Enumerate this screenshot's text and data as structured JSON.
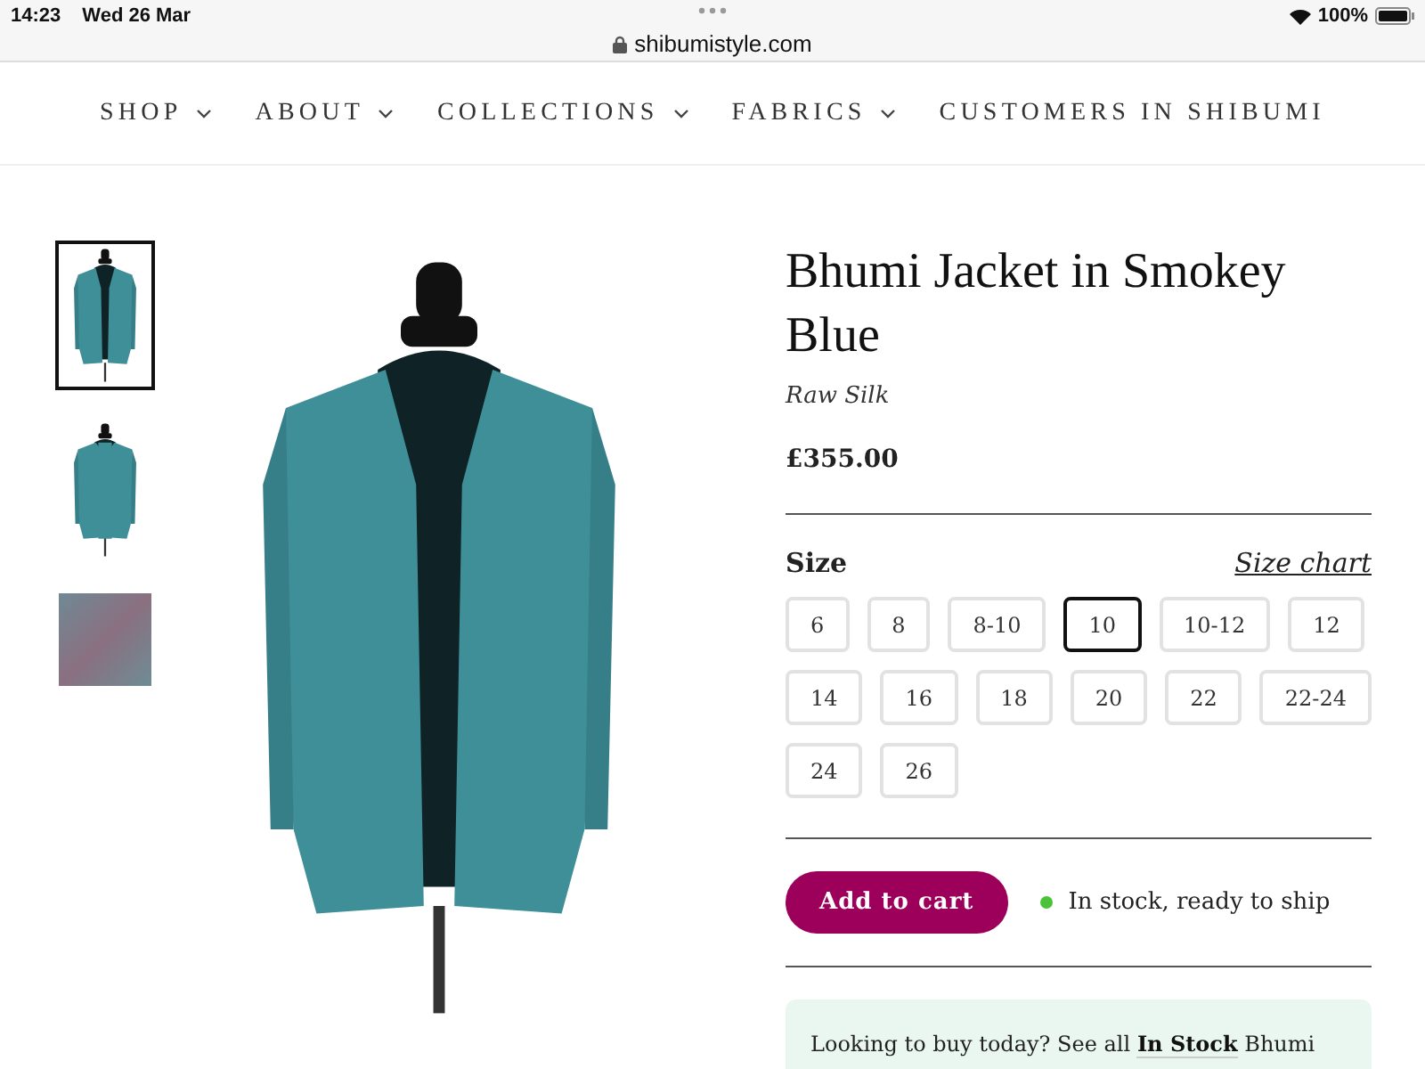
{
  "status_bar": {
    "time": "14:23",
    "date": "Wed 26 Mar",
    "url": "shibumistyle.com",
    "battery": "100%"
  },
  "nav": [
    {
      "label": "SHOP",
      "dropdown": true
    },
    {
      "label": "ABOUT",
      "dropdown": true
    },
    {
      "label": "COLLECTIONS",
      "dropdown": true
    },
    {
      "label": "FABRICS",
      "dropdown": true
    },
    {
      "label": "CUSTOMERS IN SHIBUMI",
      "dropdown": false
    }
  ],
  "gallery": {
    "thumbnails": [
      {
        "kind": "front",
        "selected": true
      },
      {
        "kind": "back",
        "selected": false
      },
      {
        "kind": "fabric",
        "selected": false
      }
    ]
  },
  "product": {
    "title": "Bhumi Jacket in Smokey Blue",
    "fabric": "Raw Silk",
    "price": "£355.00",
    "size_label": "Size",
    "size_chart": "Size chart",
    "sizes": [
      {
        "label": "6",
        "selected": false
      },
      {
        "label": "8",
        "selected": false
      },
      {
        "label": "8-10",
        "selected": false
      },
      {
        "label": "10",
        "selected": true
      },
      {
        "label": "10-12",
        "selected": false
      },
      {
        "label": "12",
        "selected": false
      },
      {
        "label": "14",
        "selected": false
      },
      {
        "label": "16",
        "selected": false
      },
      {
        "label": "18",
        "selected": false
      },
      {
        "label": "20",
        "selected": false
      },
      {
        "label": "22",
        "selected": false
      },
      {
        "label": "22-24",
        "selected": false
      },
      {
        "label": "24",
        "selected": false
      },
      {
        "label": "26",
        "selected": false
      }
    ],
    "add_to_cart": "Add to cart",
    "stock": {
      "text": "In stock, ready to ship",
      "in_stock": true
    },
    "notice": {
      "before": "Looking to buy today? See all",
      "link": "In Stock",
      "after": "Bhumi"
    }
  }
}
